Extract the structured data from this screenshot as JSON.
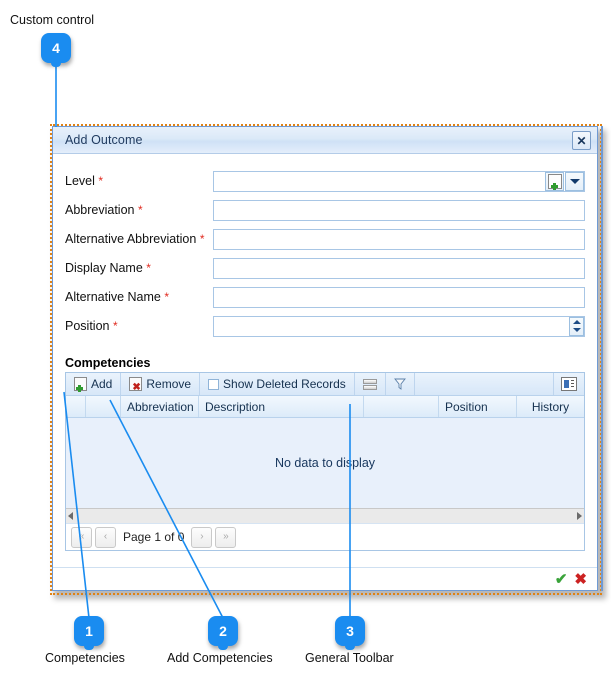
{
  "annotations": {
    "top_label": "Custom control",
    "badges": [
      {
        "num": "4",
        "label": "Custom control"
      },
      {
        "num": "1",
        "label": "Competencies"
      },
      {
        "num": "2",
        "label": "Add Competencies"
      },
      {
        "num": "3",
        "label": "General Toolbar"
      }
    ],
    "bottom_labels": [
      "Competencies",
      "Add Competencies",
      "General Toolbar"
    ],
    "accent_color": "#1a8cf0",
    "line_color": "#1a8cf0",
    "selection_color": "#E08214"
  },
  "dialog": {
    "title": "Add Outcome",
    "close_icon": "✕",
    "form": {
      "fields": [
        {
          "label": "Level",
          "required": "*",
          "value": "",
          "type": "lookup"
        },
        {
          "label": "Abbreviation",
          "required": "*",
          "value": "",
          "type": "text"
        },
        {
          "label": "Alternative Abbreviation",
          "required": "*",
          "value": "",
          "type": "text"
        },
        {
          "label": "Display Name",
          "required": "*",
          "value": "",
          "type": "text"
        },
        {
          "label": "Alternative Name",
          "required": "*",
          "value": "",
          "type": "text"
        },
        {
          "label": "Position",
          "required": "*",
          "value": "",
          "type": "spinner"
        }
      ]
    },
    "competencies": {
      "section_title": "Competencies",
      "toolbar": {
        "add_label": "Add",
        "remove_label": "Remove",
        "show_deleted_label": "Show Deleted Records",
        "show_deleted_checked": false,
        "icons": [
          "new-document-icon",
          "delete-document-icon",
          "checkbox-icon",
          "column-chooser-icon",
          "filter-funnel-icon",
          "detail-layout-icon"
        ]
      },
      "columns": [
        "",
        "",
        "Abbreviation",
        "Description",
        "",
        "Position",
        "History"
      ],
      "rows": [],
      "empty_text": "No data to display",
      "pager": {
        "first_label": "«",
        "prev_label": "‹",
        "page_text": "Page 1 of 0",
        "next_label": "›",
        "last_label": "»"
      }
    },
    "footer": {
      "ok_icon": "✔",
      "cancel_icon": "✖"
    }
  }
}
